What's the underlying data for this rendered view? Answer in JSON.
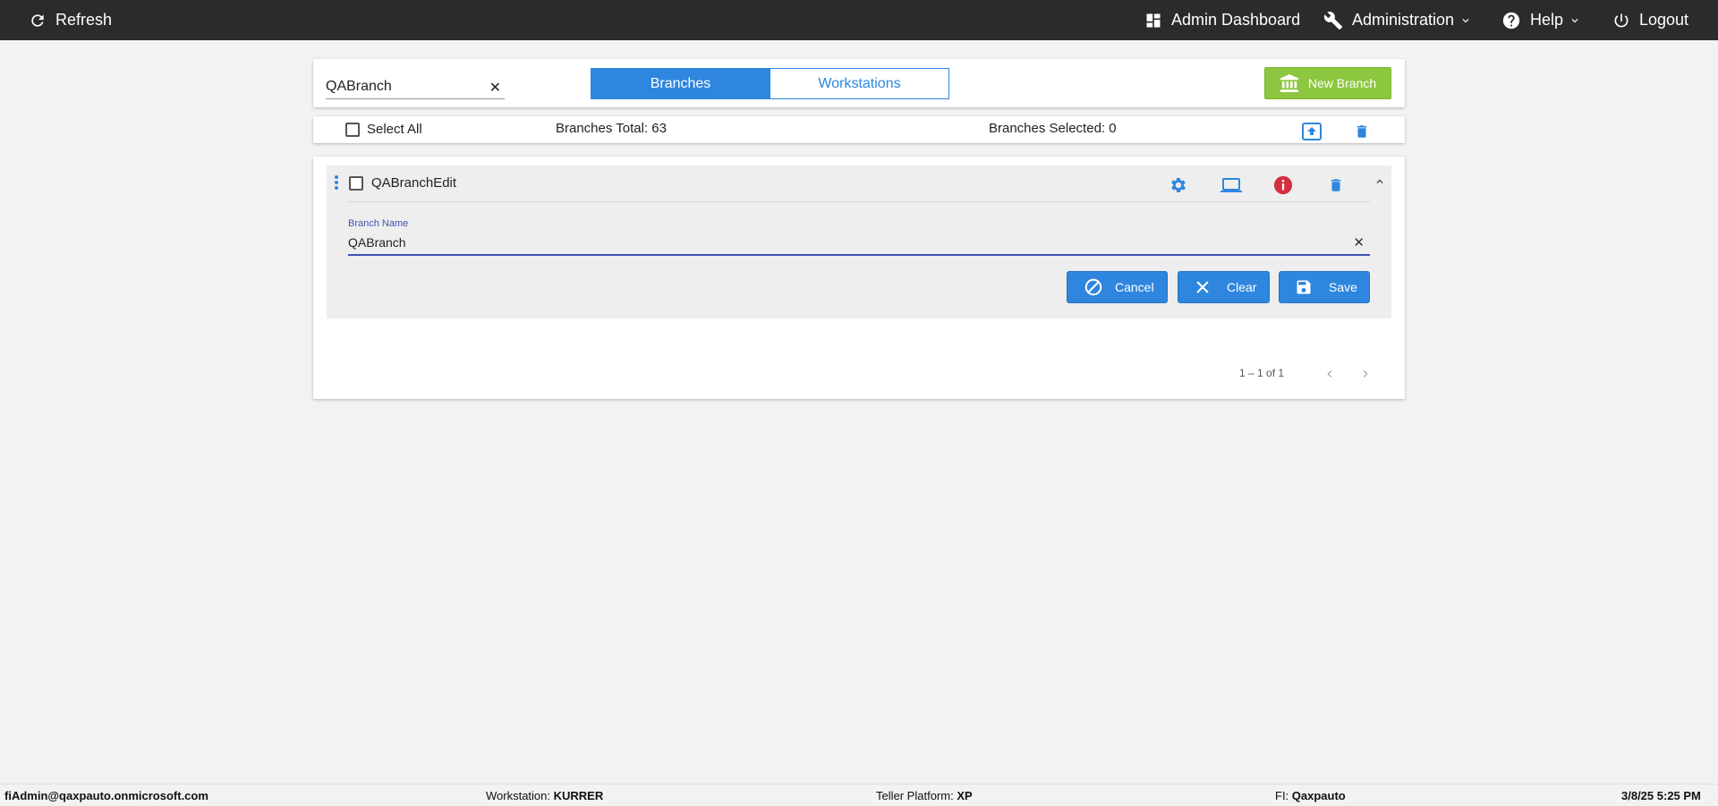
{
  "topbar": {
    "refresh_label": "Refresh",
    "admin_dashboard_label": "Admin Dashboard",
    "administration_label": "Administration",
    "help_label": "Help",
    "logout_label": "Logout"
  },
  "toolbar": {
    "search_value": "QABranch",
    "clear_symbol": "✕",
    "tabs": [
      {
        "label": "Branches",
        "active": true
      },
      {
        "label": "Workstations",
        "active": false
      }
    ],
    "new_branch_label": "New Branch"
  },
  "summary": {
    "select_all_label": "Select All",
    "branches_total": "Branches Total: 63",
    "branches_selected": "Branches Selected: 0"
  },
  "branch_row": {
    "name": "QABranchEdit",
    "field_label": "Branch Name",
    "field_value": "QABranch",
    "field_clear": "✕",
    "cancel_label": "Cancel",
    "clear_label": "Clear",
    "save_label": "Save"
  },
  "pagination": {
    "range": "1 – 1 of 1"
  },
  "footer": {
    "user": "fiAdmin@qaxpauto.onmicrosoft.com",
    "workstation_label": "Workstation: ",
    "workstation_value": "KURRER",
    "teller_label": "Teller Platform: ",
    "teller_value": "XP",
    "fi_label": "FI: ",
    "fi_value": "Qaxpauto",
    "datetime": "3/8/25 5:25 PM"
  },
  "colors": {
    "topbar_bg": "#2b2b2b",
    "primary_blue": "#2e86de",
    "new_branch_green": "#8dc63f",
    "info_red": "#d32f3f",
    "field_accent": "#3f51b5"
  }
}
